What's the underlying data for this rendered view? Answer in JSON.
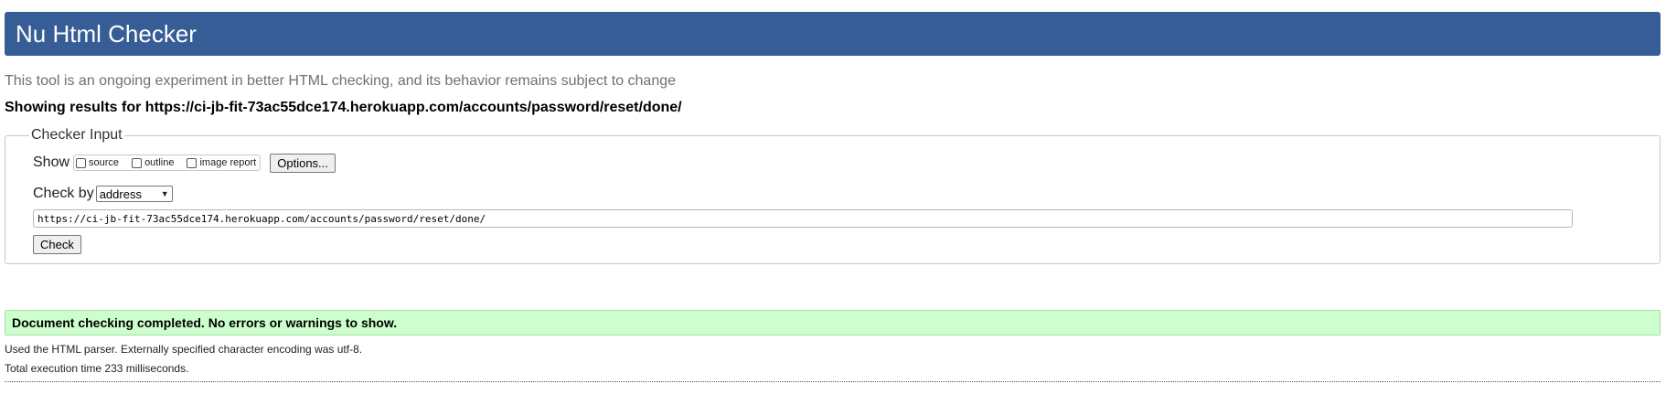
{
  "header": {
    "title": "Nu Html Checker"
  },
  "intro": "This tool is an ongoing experiment in better HTML checking, and its behavior remains subject to change",
  "showing_results": "Showing results for https://ci-jb-fit-73ac55dce174.herokuapp.com/accounts/password/reset/done/",
  "checker_input": {
    "legend": "Checker Input",
    "show_label": "Show",
    "show_options": [
      {
        "label": "source",
        "checked": false
      },
      {
        "label": "outline",
        "checked": false
      },
      {
        "label": "image report",
        "checked": false
      }
    ],
    "options_button": "Options...",
    "check_by_label": "Check by",
    "check_by_value": "address",
    "url_value": "https://ci-jb-fit-73ac55dce174.herokuapp.com/accounts/password/reset/done/",
    "check_button": "Check"
  },
  "result": {
    "message": "Document checking completed. No errors or warnings to show.",
    "details": [
      "Used the HTML parser. Externally specified character encoding was utf-8.",
      "Total execution time 233 milliseconds."
    ]
  },
  "colors": {
    "header_bg": "#365d95",
    "success_bg": "#ccffcc"
  }
}
